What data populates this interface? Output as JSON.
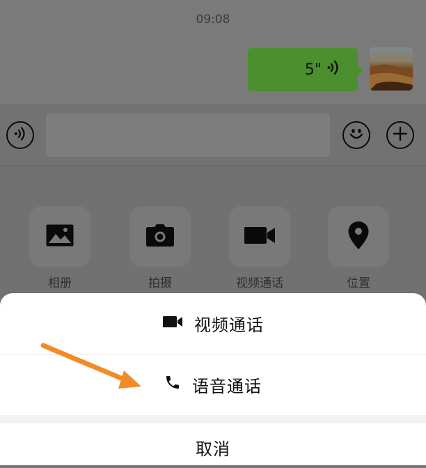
{
  "status": {
    "time": "09:08"
  },
  "chat": {
    "voice_message": {
      "duration": "5\""
    }
  },
  "input_bar": {
    "left_icon": "voice-wave-icon",
    "right_icons": [
      "emoji-icon",
      "plus-icon"
    ]
  },
  "panel": {
    "items": [
      {
        "label": "相册",
        "icon": "image-icon"
      },
      {
        "label": "拍摄",
        "icon": "camera-icon"
      },
      {
        "label": "视频通话",
        "icon": "video-camera-icon"
      },
      {
        "label": "位置",
        "icon": "location-pin-icon"
      }
    ]
  },
  "sheet": {
    "video_call_label": "视频通话",
    "voice_call_label": "语音通话",
    "cancel_label": "取消"
  },
  "colors": {
    "bubble": "#4c8f2f",
    "annotation_arrow": "#f28a26",
    "overlay": "#767676"
  }
}
